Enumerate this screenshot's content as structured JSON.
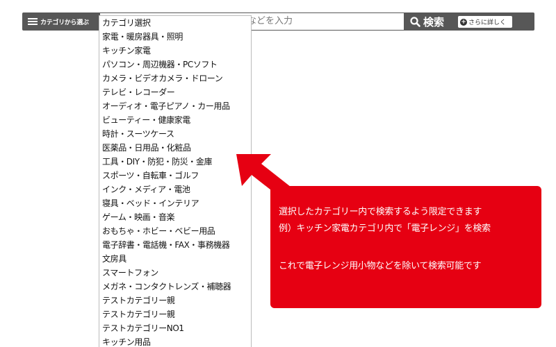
{
  "search_bar": {
    "category_button_label": "カテゴリから選ぶ",
    "search_placeholder": "などを入力",
    "search_button_label": "検索",
    "detail_button_label": "さらに詳しく"
  },
  "dropdown": {
    "items": [
      "カテゴリ選択",
      "家電・暖房器具・照明",
      "キッチン家電",
      "パソコン・周辺機器・PCソフト",
      "カメラ・ビデオカメラ・ドローン",
      "テレビ・レコーダー",
      "オーディオ・電子ピアノ・カー用品",
      "ビューティー・健康家電",
      "時計・スーツケース",
      "医薬品・日用品・化粧品",
      "工具・DIY・防犯・防災・金庫",
      "スポーツ・自転車・ゴルフ",
      "インク・メディア・電池",
      "寝具・ベッド・インテリア",
      "ゲーム・映画・音楽",
      "おもちゃ・ホビー・ベビー用品",
      "電子辞書・電話機・FAX・事務機器",
      "文房具",
      "スマートフォン",
      "メガネ・コンタクトレンズ・補聴器",
      "テストカテゴリー親",
      "テストカテゴリー親",
      "テストカテゴリーNO1",
      "キッチン用品"
    ]
  },
  "callout": {
    "line1": "選択したカテゴリー内で検索するよう限定できます",
    "line2": "例）キッチン家電カテゴリ内で「電子レンジ」を検索",
    "line3": "これで電子レンジ用小物などを除いて検索可能です"
  },
  "colors": {
    "bar": "#575757",
    "callout": "#e60012",
    "text": "#111111"
  },
  "icons": {
    "menu": "menu-icon",
    "search": "search-icon",
    "detail": "plus-circle-icon"
  }
}
